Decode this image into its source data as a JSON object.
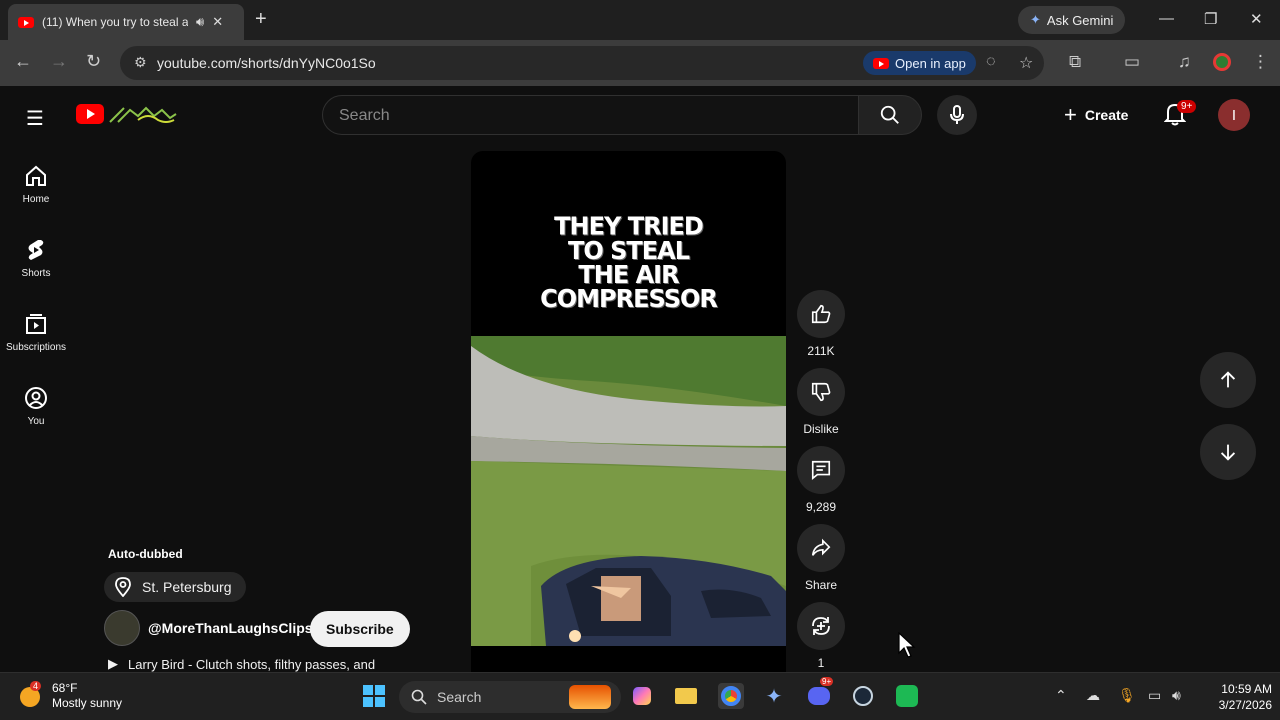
{
  "browser": {
    "tab_title": "(11) When you try to steal a",
    "new_tab_symbol": "+",
    "ask_gemini": "Ask Gemini",
    "url": "youtube.com/shorts/dnYyNC0o1So",
    "open_in_app": "Open in app"
  },
  "youtube": {
    "search_placeholder": "Search",
    "create_label": "Create",
    "notification_badge": "9+",
    "avatar_letter": "I",
    "sidebar": [
      {
        "label": "Home",
        "icon": "home-icon"
      },
      {
        "label": "Shorts",
        "icon": "shorts-icon"
      },
      {
        "label": "Subscriptions",
        "icon": "subscriptions-icon"
      },
      {
        "label": "You",
        "icon": "you-icon"
      }
    ],
    "video_overlay_title": [
      "THEY TRIED",
      "TO STEAL",
      "THE AIR",
      "COMPRESSOR"
    ],
    "actions": {
      "like_count": "211K",
      "dislike_label": "Dislike",
      "comment_count": "9,289",
      "share_label": "Share",
      "remix_count": "1"
    },
    "auto_dubbed": "Auto-dubbed",
    "location": "St. Petersburg",
    "channel": "@MoreThanLaughsClips",
    "subscribe_label": "Subscribe",
    "music": "Larry Bird - Clutch shots, filthy passes, and"
  },
  "taskbar": {
    "weather_badge": "4",
    "temperature": "68°F",
    "condition": "Mostly sunny",
    "search_label": "Search",
    "discord_badge": "9+",
    "time": "10:59 AM",
    "date": "3/27/2026"
  },
  "colors": {
    "accent_red": "#ff0000",
    "background": "#0f0f0f",
    "open_in_app_bg": "#1a3a6b"
  }
}
